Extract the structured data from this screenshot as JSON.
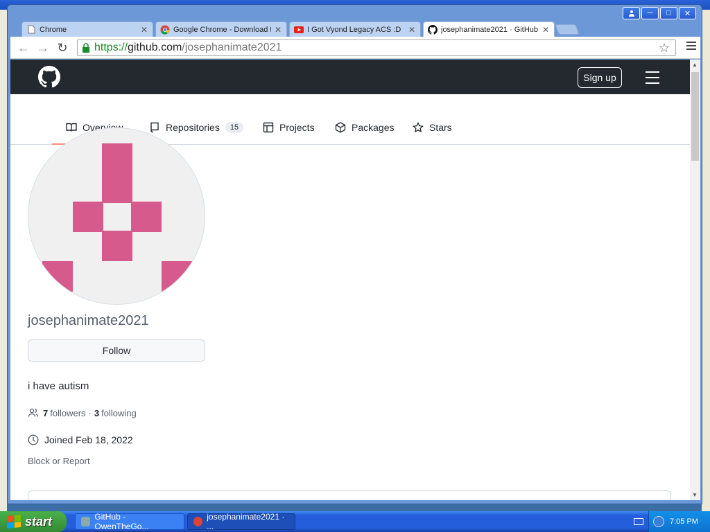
{
  "browser": {
    "tabs": [
      {
        "title": "Chrome",
        "icon": "page-icon",
        "active": false
      },
      {
        "title": "Google Chrome - Download t",
        "icon": "chrome-icon",
        "active": false
      },
      {
        "title": "I Got Vyond Legacy ACS :D",
        "icon": "youtube-icon",
        "active": false
      },
      {
        "title": "josephanimate2021 · GitHub",
        "icon": "github-icon",
        "active": true
      }
    ],
    "url": {
      "scheme": "https://",
      "host": "github.com",
      "path": "/josephanimate2021"
    }
  },
  "header": {
    "signup_label": "Sign up"
  },
  "nav_tabs": [
    {
      "label": "Overview",
      "icon": "book-icon"
    },
    {
      "label": "Repositories",
      "icon": "repo-icon",
      "count": "15"
    },
    {
      "label": "Projects",
      "icon": "table-icon"
    },
    {
      "label": "Packages",
      "icon": "package-icon"
    },
    {
      "label": "Stars",
      "icon": "star-icon"
    }
  ],
  "profile": {
    "username": "josephanimate2021",
    "follow_label": "Follow",
    "bio": "i have autism",
    "followers_count": "7",
    "followers_label": "followers",
    "separator": "·",
    "following_count": "3",
    "following_label": "following",
    "joined": "Joined Feb 18, 2022",
    "block_report": "Block or Report"
  },
  "taskbar": {
    "start_label": "start",
    "items": [
      {
        "label": "GitHub - OwenTheGo..."
      },
      {
        "label": "josephanimate2021 · ..."
      }
    ],
    "clock": "7:05 PM"
  },
  "colors": {
    "github_header": "#24292f",
    "avatar_pink": "#d65a8b",
    "xp_blue": "#245edb",
    "xp_green": "#338a33",
    "url_green": "#1a8a2a"
  }
}
